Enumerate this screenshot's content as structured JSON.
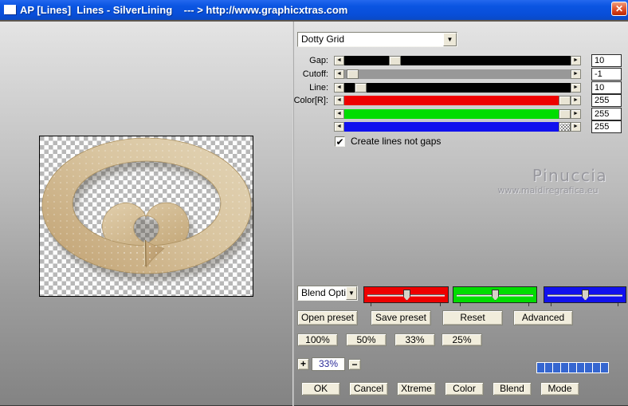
{
  "window": {
    "title": "AP [Lines]  Lines - SilverLining    --- > http://www.graphicxtras.com",
    "close_label": "X"
  },
  "preset_dropdown": {
    "value": "Dotty Grid"
  },
  "sliders": [
    {
      "label": "Gap:",
      "value": "10",
      "track_color": "#000000",
      "thumb_frac": 0.208,
      "thumb_style": "solid"
    },
    {
      "label": "Cutoff:",
      "value": "-1",
      "track_color": "#989898",
      "thumb_frac": 0.011,
      "thumb_style": "solid"
    },
    {
      "label": "Line:",
      "value": "10",
      "track_color": "#000000",
      "thumb_frac": 0.048,
      "thumb_style": "solid"
    },
    {
      "label": "Color[R]:",
      "value": "255",
      "track_color": "#ee0000",
      "thumb_frac": 1.0,
      "thumb_style": "solid"
    },
    {
      "label": "",
      "value": "255",
      "track_color": "#00dd00",
      "thumb_frac": 1.0,
      "thumb_style": "solid"
    },
    {
      "label": "",
      "value": "255",
      "track_color": "#1111ee",
      "thumb_frac": 1.0,
      "thumb_style": "dither"
    }
  ],
  "checkbox": {
    "label": "Create lines not gaps",
    "checked": true,
    "check_glyph": "✔"
  },
  "watermark": {
    "line1": "Pinuccia",
    "line2": "www.maidiregrafica.eu"
  },
  "blend_dropdown": {
    "value": "Blend Opti"
  },
  "rgb_sliders": [
    {
      "name": "red-blend-slider",
      "color": "#ee0000"
    },
    {
      "name": "green-blend-slider",
      "color": "#00dd00"
    },
    {
      "name": "blue-blend-slider",
      "color": "#1111ee"
    }
  ],
  "preset_buttons": [
    "Open preset",
    "Save preset",
    "Reset",
    "Advanced"
  ],
  "zoom_buttons": [
    "100%",
    "50%",
    "33%",
    "25%"
  ],
  "zoom_stepper": {
    "plus": "+",
    "value": "33%",
    "minus": "−"
  },
  "progress": {
    "segments": 9,
    "color": "#3566d0"
  },
  "action_buttons": [
    "OK",
    "Cancel",
    "Xtreme",
    "Color",
    "Blend",
    "Mode"
  ]
}
